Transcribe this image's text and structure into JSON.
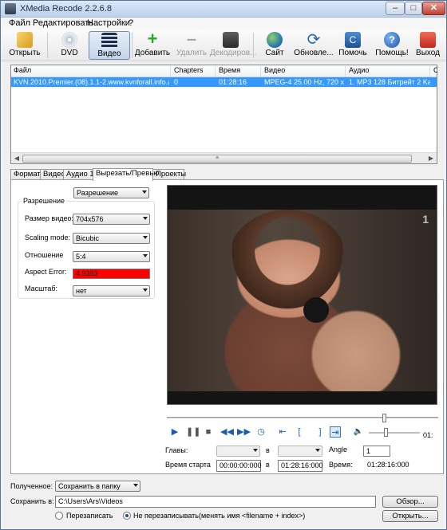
{
  "window": {
    "title": "XMedia Recode 2.2.6.8"
  },
  "menu": [
    "Файл",
    "Редактировать",
    "Настройки",
    "?"
  ],
  "toolbar": {
    "open": "Открыть",
    "dvd": "DVD",
    "video": "Видео",
    "add": "Добавить",
    "delete": "Удалить",
    "decode": "Декодиров...",
    "site": "Сайт",
    "update": "Обновле...",
    "help": "Помочь",
    "help2": "Помощь!",
    "exit": "Выход"
  },
  "grid": {
    "columns": [
      "Файл",
      "Chapters",
      "Время",
      "Видео",
      "Аудио",
      "С"
    ],
    "rows": [
      [
        "KVN.2010.Premier.(08).1.1-2.www.kvnforall.info.avi",
        "0",
        "01:28:16",
        "MPEG-4 25.00 Hz, 720 x 5...",
        "1. MP3 128 Битрейт 2 Ka...",
        ""
      ]
    ]
  },
  "tabs": [
    "Формат",
    "Видео",
    "Аудио 1",
    "Вырезать/Превью",
    "Проекты"
  ],
  "tabs_active_index": 3,
  "preview": {
    "mode": "Разрешение",
    "group_title": "Разрешение",
    "size_label": "Размер видео:",
    "size_value": "704x576",
    "scaling_label": "Scaling mode:",
    "scaling_value": "Bicubic",
    "ratio_label": "Отношение",
    "ratio_value": "5:4",
    "aspect_label": "Aspect Error:",
    "aspect_value": "4.9383",
    "scale_label": "Масштаб:",
    "scale_value": "нет",
    "time_end": "01:",
    "chapters_label": "Главы:",
    "in_label": "в",
    "angle_label": "Angle",
    "angle_value": "1",
    "start_label": "Время старта",
    "start_value": "00:00:00:000",
    "in2_label": "в",
    "end_value": "01:28:16:000",
    "duration_label": "Время:",
    "duration_value": "01:28:16:000",
    "logo": "1"
  },
  "bottom": {
    "output_label": "Полученное:",
    "output_value": "Сохранить в папку",
    "save_label": "Сохранить в:",
    "path": "C:\\Users\\Ars\\Videos",
    "browse": "Обзор...",
    "open": "Открыть...",
    "overwrite": "Перезаписать",
    "no_overwrite": "Не перезаписывать(менять имя <filename + index>)"
  },
  "colors": {
    "selection": "#3399ff",
    "aspect_error": "#ff0000"
  }
}
